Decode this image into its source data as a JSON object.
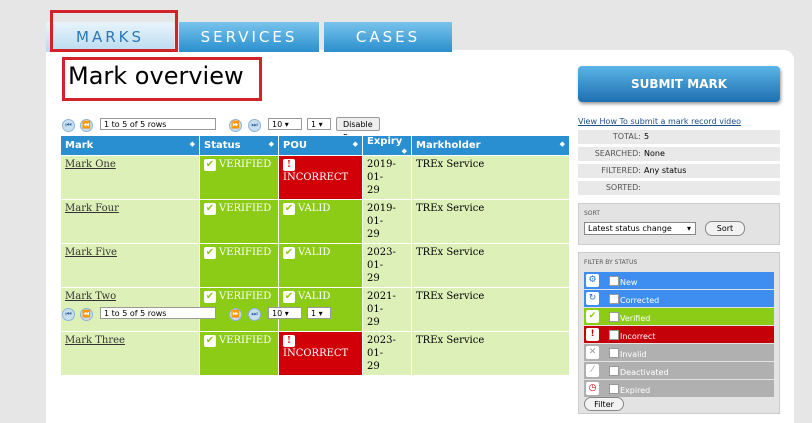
{
  "tabs": [
    {
      "label": "MARKS",
      "active": true
    },
    {
      "label": "SERVICES",
      "active": false
    },
    {
      "label": "CASES",
      "active": false
    }
  ],
  "page_title": "Mark overview",
  "pager_top": {
    "range": "1 to 5 of 5 rows",
    "page_size": "10",
    "page": "1",
    "disable_label": "Disable Pager"
  },
  "pager_bottom": {
    "range": "1 to 5 of 5 rows",
    "page_size": "10",
    "page": "1"
  },
  "table": {
    "headers": [
      "Mark",
      "Status",
      "POU",
      "Expiry",
      "Markholder"
    ],
    "rows": [
      {
        "mark": "Mark One",
        "status": "VERIFIED",
        "pou": "INCORRECT",
        "expiry_a": "2019-01-",
        "expiry_b": "29",
        "holder": "TREx Service"
      },
      {
        "mark": "Mark Four",
        "status": "VERIFIED",
        "pou": "VALID",
        "expiry_a": "2019-01-",
        "expiry_b": "29",
        "holder": "TREx Service"
      },
      {
        "mark": "Mark Five",
        "status": "VERIFIED",
        "pou": "VALID",
        "expiry_a": "2023-01-",
        "expiry_b": "29",
        "holder": "TREx Service"
      },
      {
        "mark": "Mark Two",
        "status": "VERIFIED",
        "pou": "VALID",
        "expiry_a": "2021-01-",
        "expiry_b": "29",
        "holder": "TREx Service"
      },
      {
        "mark": "Mark Three",
        "status": "VERIFIED",
        "pou": "INCORRECT",
        "expiry_a": "2023-01-",
        "expiry_b": "29",
        "holder": "TREx Service"
      }
    ]
  },
  "sidebar": {
    "submit_label": "SUBMIT MARK",
    "video_link": "View How To submit a mark record video",
    "stats": [
      {
        "label": "TOTAL:",
        "value": "5"
      },
      {
        "label": "SEARCHED:",
        "value": "None"
      },
      {
        "label": "FILTERED:",
        "value": "Any status"
      },
      {
        "label": "SORTED:",
        "value": ""
      }
    ],
    "sort_heading": "SORT",
    "sort_value": "Latest status change",
    "sort_button": "Sort",
    "filter_heading": "FILTER BY STATUS",
    "filters": [
      {
        "label": "New",
        "color": "#3d8ef0",
        "icon": "gear-icon"
      },
      {
        "label": "Corrected",
        "color": "#3d8ef0",
        "icon": "refresh-icon"
      },
      {
        "label": "Verified",
        "color": "#8ccc16",
        "icon": "check-icon"
      },
      {
        "label": "Incorrect",
        "color": "#c40008",
        "icon": "warning-icon"
      },
      {
        "label": "Invalid",
        "color": "#b0b0b0",
        "icon": "x-icon"
      },
      {
        "label": "Deactivated",
        "color": "#b0b0b0",
        "icon": "slash-icon"
      },
      {
        "label": "Expired",
        "color": "#b0b0b0",
        "icon": "clock-icon"
      }
    ],
    "filter_button": "Filter"
  }
}
